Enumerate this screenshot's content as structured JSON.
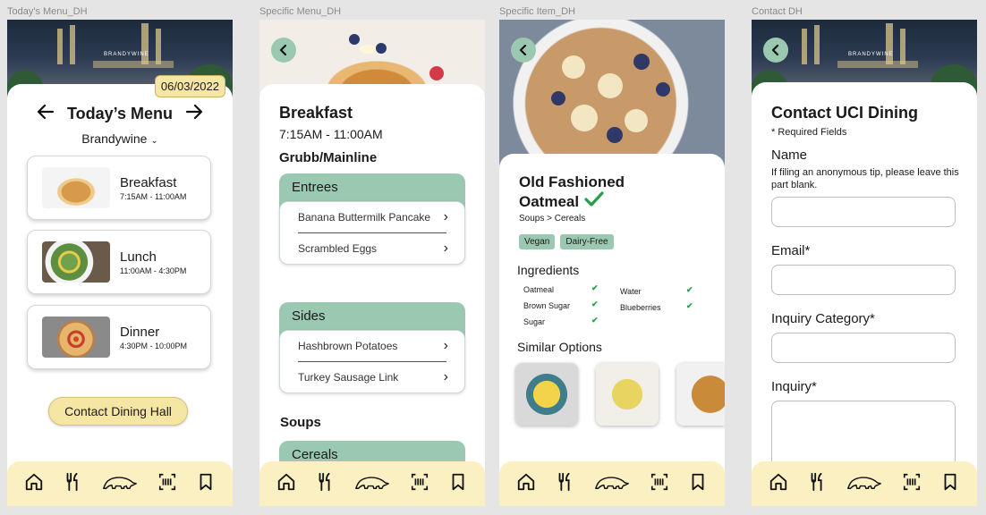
{
  "frames": [
    "Today's Menu_DH",
    "Specific Menu_DH",
    "Specific Item_DH",
    "Contact DH"
  ],
  "nav": {
    "icons": [
      "home-icon",
      "utensils-icon",
      "anteater-icon",
      "barcode-scan-icon",
      "bookmark-icon"
    ]
  },
  "todays_menu": {
    "date": "06/03/2022",
    "title": "Today’s Menu",
    "hall": "Brandywine",
    "sign": "BRANDYWINE",
    "meals": [
      {
        "name": "Breakfast",
        "time": "7:15AM - 11:00AM"
      },
      {
        "name": "Lunch",
        "time": "11:00AM - 4:30PM"
      },
      {
        "name": "Dinner",
        "time": "4:30PM - 10:00PM"
      }
    ],
    "contact_button": "Contact Dining Hall"
  },
  "specific_menu": {
    "meal": "Breakfast",
    "hours": "7:15AM - 11:00AM",
    "station": "Grubb/Mainline",
    "sections": [
      {
        "title": "Entrees",
        "items": [
          "Banana Buttermilk Pancake",
          "Scrambled Eggs"
        ]
      },
      {
        "title": "Sides",
        "items": [
          "Hashbrown Potatoes",
          "Turkey Sausage Link"
        ]
      }
    ],
    "soups_label": "Soups",
    "cereals_label": "Cereals"
  },
  "specific_item": {
    "name_line1": "Old Fashioned",
    "name_line2": "Oatmeal",
    "category": "Soups > Cereals",
    "tags": [
      "Vegan",
      "Dairy-Free"
    ],
    "ingredients_label": "Ingredients",
    "ingredients_left": [
      "Oatmeal",
      "Brown Sugar",
      "Sugar"
    ],
    "ingredients_right": [
      "Water",
      "Blueberries"
    ],
    "similar_label": "Similar Options"
  },
  "contact": {
    "title": "Contact UCI Dining",
    "required_note": "* Required Fields",
    "name_label": "Name",
    "name_hint": "If filing an anonymous tip, please leave this part blank.",
    "email_label": "Email*",
    "category_label": "Inquiry Category*",
    "inquiry_label": "Inquiry*"
  }
}
